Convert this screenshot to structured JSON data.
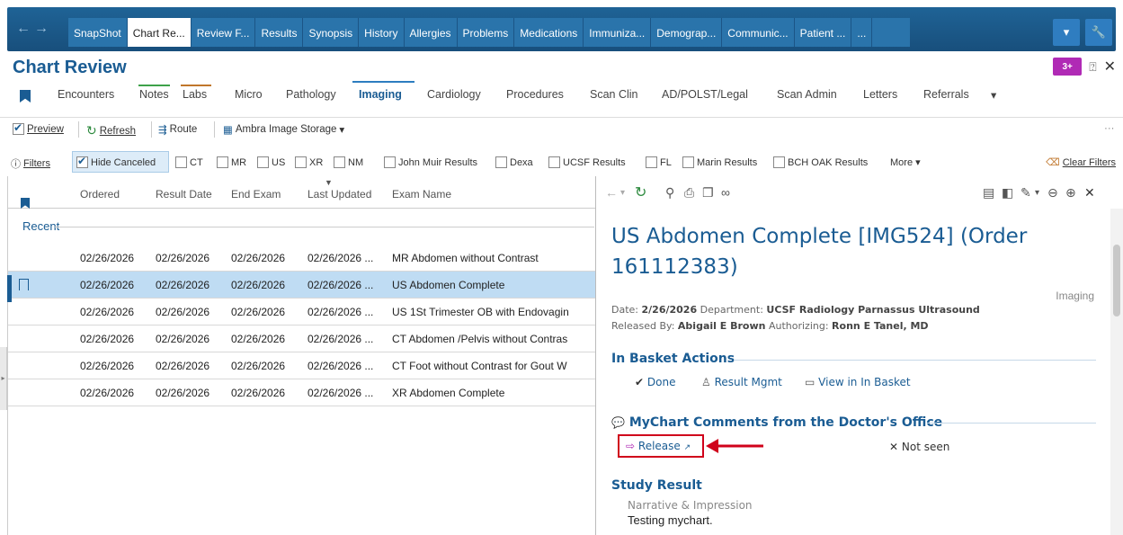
{
  "nav": {
    "tabs": [
      "SnapShot",
      "Chart Re...",
      "Review F...",
      "Results",
      "Synopsis",
      "History",
      "Allergies",
      "Problems",
      "Medications",
      "Immuniza...",
      "Demograp...",
      "Communic...",
      "Patient ...",
      "..."
    ],
    "active_tab": 1,
    "menu_glyph": "▾",
    "wrench_glyph": "🔧"
  },
  "activity": {
    "title": "Chart Review",
    "badge": "3+"
  },
  "subtabs": [
    "Encounters",
    "Notes",
    "Labs",
    "Micro",
    "Pathology",
    "Imaging",
    "Cardiology",
    "Procedures",
    "Scan Clin",
    "AD/POLST/Legal",
    "Scan Admin",
    "Letters",
    "Referrals"
  ],
  "subtab_active": "Imaging",
  "toolbar": {
    "preview": "Preview",
    "refresh": "Refresh",
    "route": "Route",
    "ambra": "Ambra Image Storage"
  },
  "filters": {
    "label": "Filters",
    "hide_canceled": "Hide Canceled",
    "options": [
      "CT",
      "MR",
      "US",
      "XR",
      "NM",
      "John Muir Results",
      "Dexa",
      "UCSF Results",
      "FL",
      "Marin Results",
      "BCH OAK Results"
    ],
    "more": "More",
    "clear": "Clear Filters"
  },
  "list": {
    "columns": [
      "Ordered",
      "Result Date",
      "End Exam",
      "Last Updated",
      "Exam Name"
    ],
    "group": "Recent",
    "rows": [
      {
        "ordered": "02/26/2026",
        "result": "02/26/2026",
        "end": "02/26/2026",
        "updated": "02/26/2026 ...",
        "exam": "MR Abdomen without Contrast"
      },
      {
        "ordered": "02/26/2026",
        "result": "02/26/2026",
        "end": "02/26/2026",
        "updated": "02/26/2026 ...",
        "exam": "US Abdomen Complete"
      },
      {
        "ordered": "02/26/2026",
        "result": "02/26/2026",
        "end": "02/26/2026",
        "updated": "02/26/2026 ...",
        "exam": "US 1St Trimester OB with Endovagin"
      },
      {
        "ordered": "02/26/2026",
        "result": "02/26/2026",
        "end": "02/26/2026",
        "updated": "02/26/2026 ...",
        "exam": "CT Abdomen /Pelvis without Contras"
      },
      {
        "ordered": "02/26/2026",
        "result": "02/26/2026",
        "end": "02/26/2026",
        "updated": "02/26/2026 ...",
        "exam": "CT Foot without Contrast for Gout W"
      },
      {
        "ordered": "02/26/2026",
        "result": "02/26/2026",
        "end": "02/26/2026",
        "updated": "02/26/2026 ...",
        "exam": "XR Abdomen Complete"
      }
    ],
    "selected_row": 1
  },
  "report": {
    "title": "US Abdomen Complete [IMG524] (Order 161112383)",
    "kind": "Imaging",
    "date_label": "Date:",
    "date": "2/26/2026",
    "dept_label": "Department:",
    "dept": "UCSF Radiology Parnassus Ultrasound",
    "released_label": "Released By:",
    "released_by": "Abigail E Brown",
    "auth_label": "Authorizing:",
    "authorizing": "Ronn E Tanel, MD",
    "inbasket_title": "In Basket Actions",
    "done": "Done",
    "result_mgmt": "Result Mgmt",
    "view_inbasket": "View in In Basket",
    "mychart_title": "MyChart Comments from the Doctor's Office",
    "release": "Release",
    "not_seen": "Not seen",
    "study_title": "Study Result",
    "narrative": "Narrative & Impression",
    "narrative_text": "Testing mychart."
  },
  "colors": {
    "brand": "#1a5c93",
    "highlight": "#d0021b",
    "selected_row": "#bfdcf3"
  }
}
